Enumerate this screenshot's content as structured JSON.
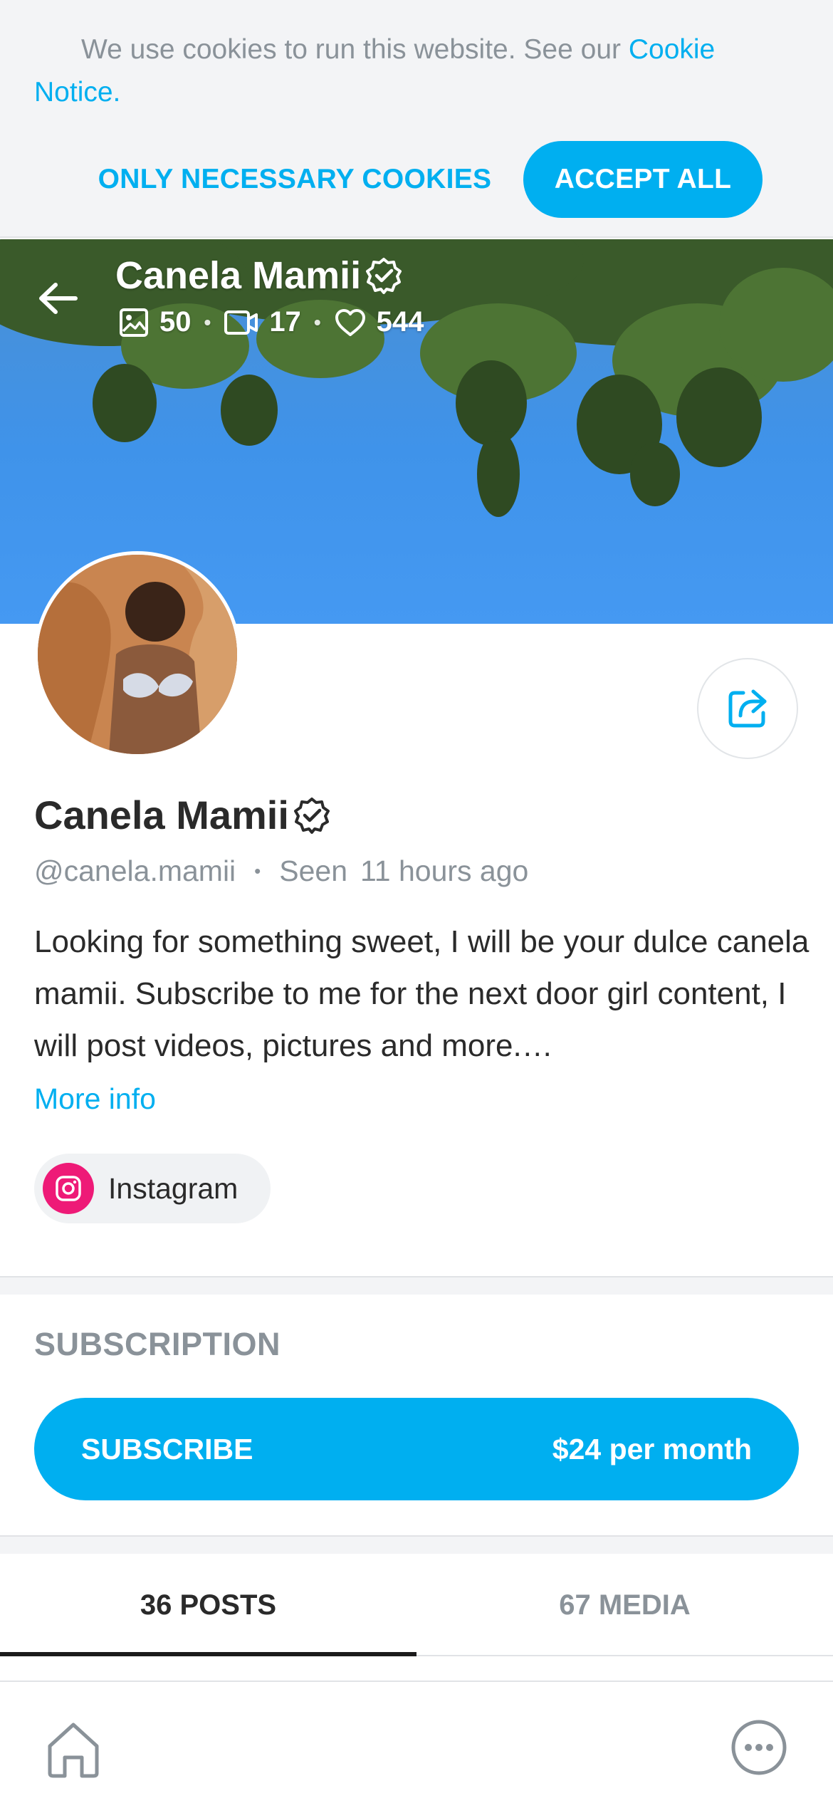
{
  "cookie_banner": {
    "text": "We use cookies to run this website. See our ",
    "link_text": "Cookie Notice",
    "text_end": ".",
    "necessary_label": "ONLY NECESSARY COOKIES",
    "accept_label": "ACCEPT ALL"
  },
  "header": {
    "name": "Canela Mamii",
    "stats": {
      "photos": "50",
      "videos": "17",
      "likes": "544"
    }
  },
  "profile": {
    "name": "Canela Mamii",
    "handle": "@canela.mamii",
    "seen_label": "Seen",
    "seen_time": "11 hours ago",
    "bio": "Looking for something sweet, I will be your dulce canela mamii. Subscribe to me for the next door girl content, I will post videos, pictures and more.…",
    "more_info": "More info",
    "social_label": "Instagram"
  },
  "subscription": {
    "title": "SUBSCRIPTION",
    "button_label": "SUBSCRIBE",
    "price": "$24 per month"
  },
  "tabs": [
    {
      "label": "36 POSTS",
      "active": true
    },
    {
      "label": "67 MEDIA",
      "active": false
    }
  ],
  "colors": {
    "accent": "#00aff0",
    "instagram": "#ee1a77",
    "sky": "#4599f2"
  }
}
